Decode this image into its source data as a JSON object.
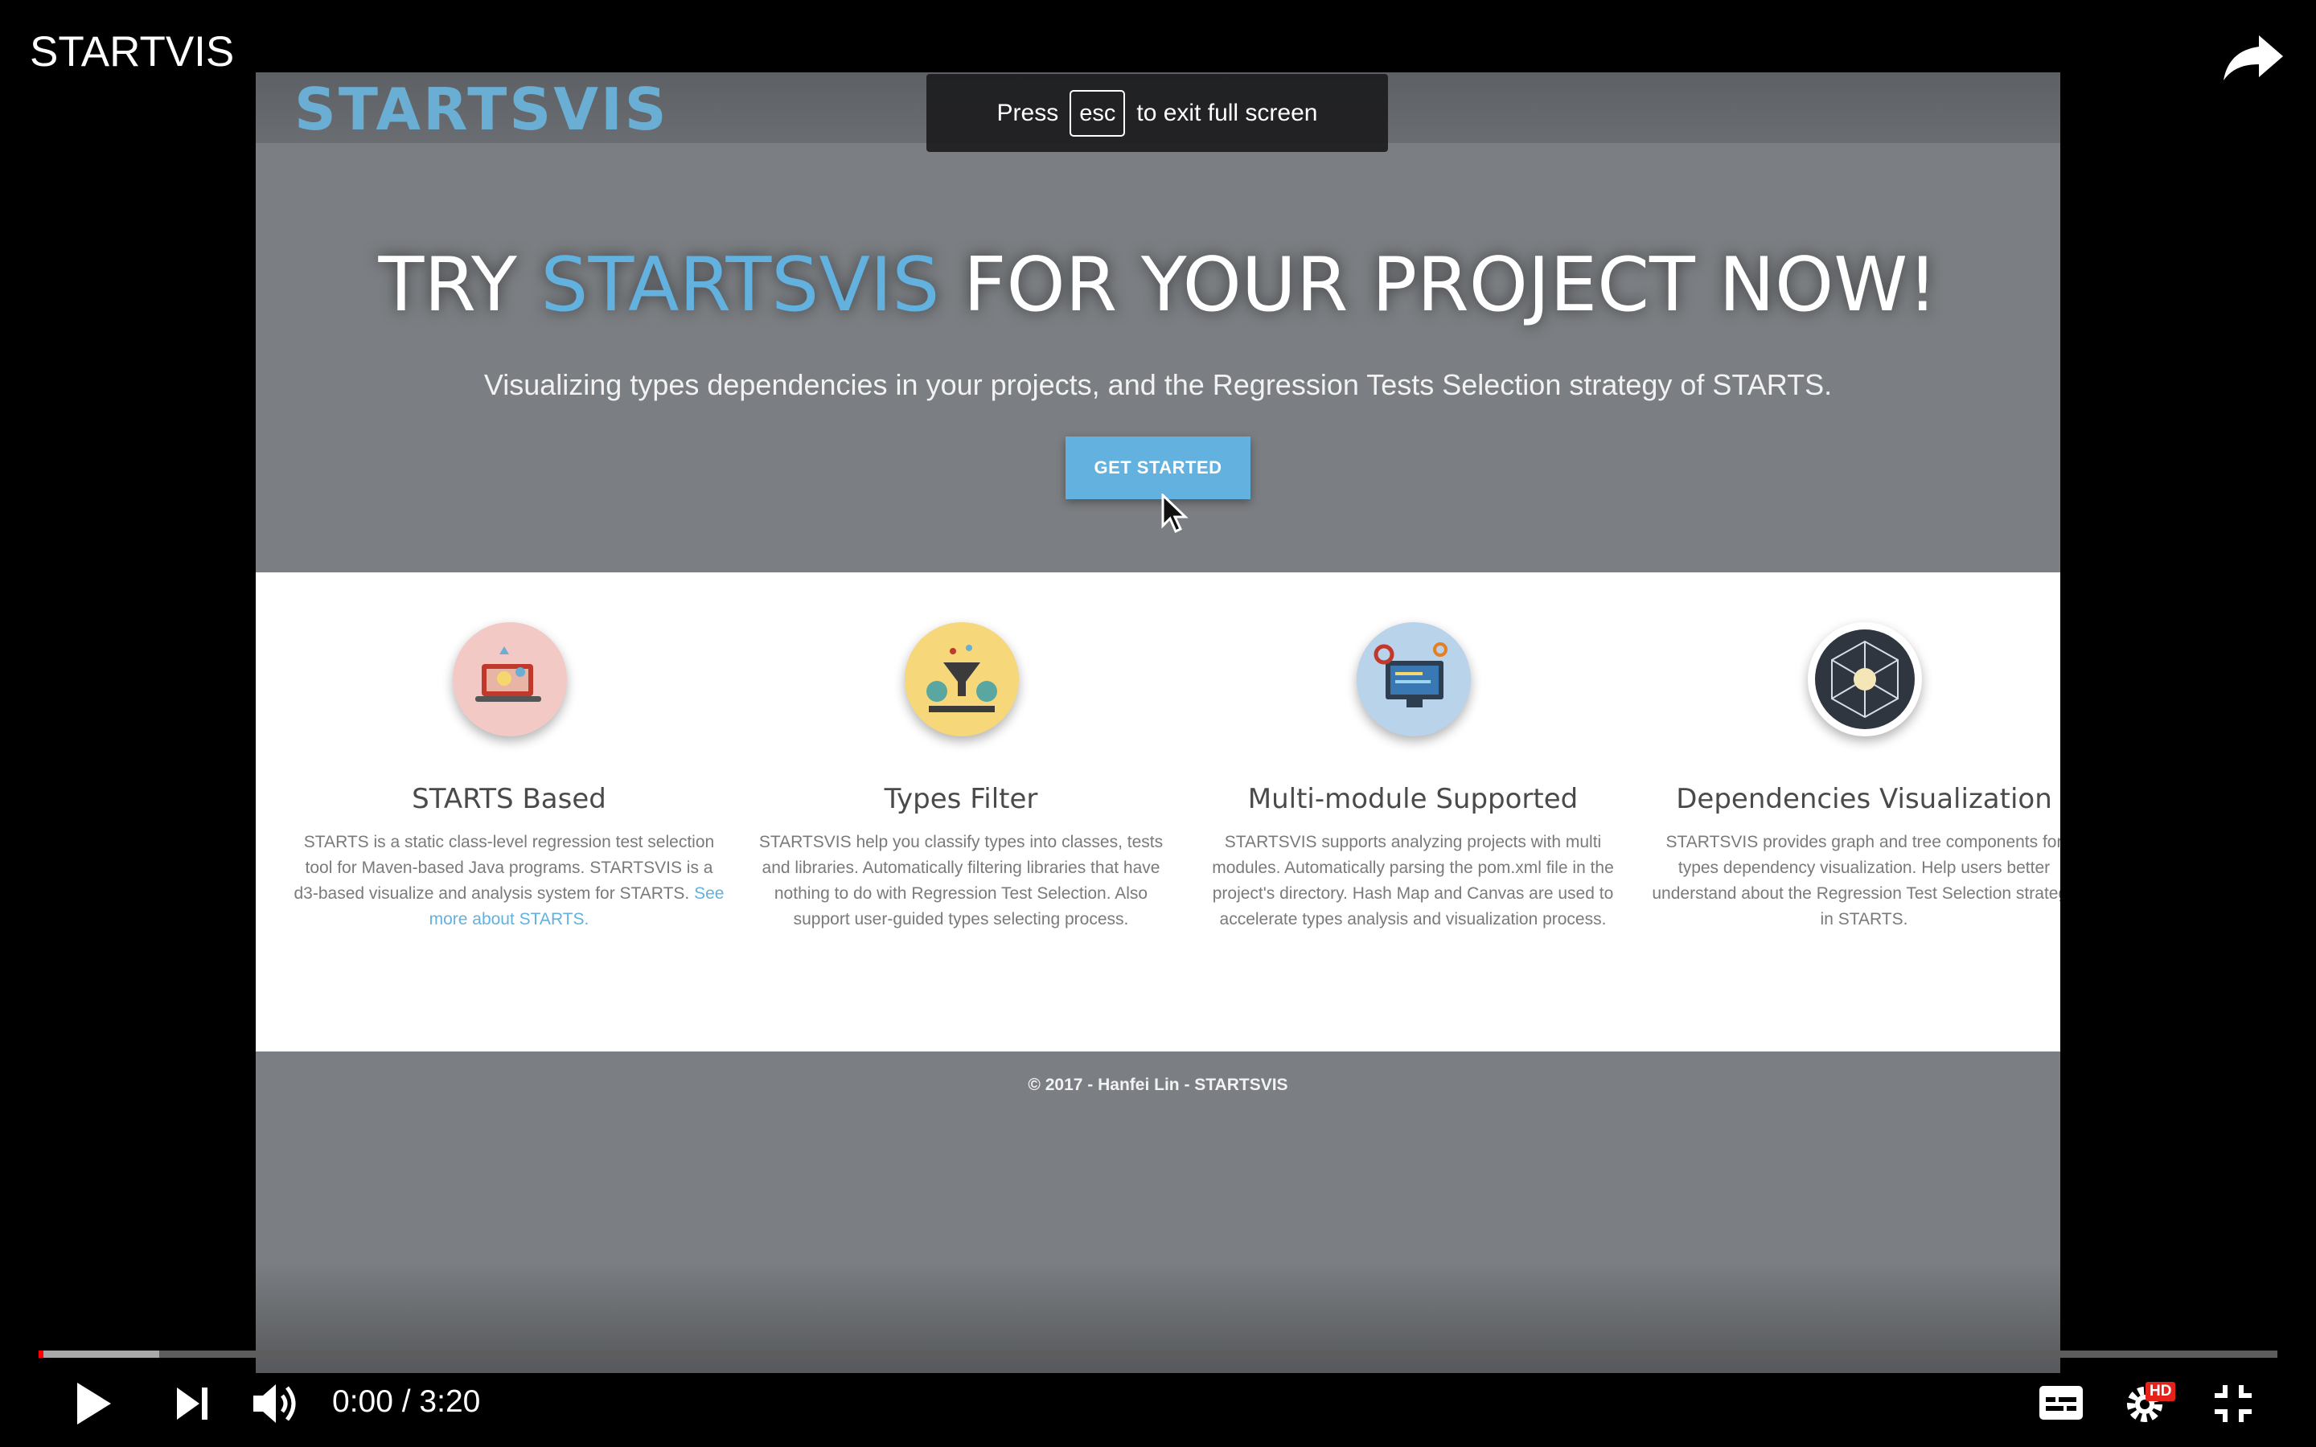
{
  "video": {
    "title": "STARTVIS"
  },
  "fullscreen_toast": {
    "press": "Press",
    "key": "esc",
    "suffix": "to exit full screen"
  },
  "site": {
    "logo": "STARTSVIS",
    "hero": {
      "title_prefix": "TRY ",
      "title_accent": "STARTSVIS",
      "title_suffix": " FOR YOUR PROJECT NOW!",
      "subtitle": "Visualizing types dependencies in your projects, and the Regression Tests Selection strategy of STARTS.",
      "cta_label": "GET STARTED"
    },
    "features": [
      {
        "title": "STARTS Based",
        "description": "STARTS is a static class-level regression test selection tool for Maven-based Java programs. STARTSVIS is a d3-based visualize and analysis system for STARTS.",
        "link": "See more about STARTS."
      },
      {
        "title": "Types Filter",
        "description": "STARTSVIS help you classify types into classes, tests and libraries. Automatically filtering libraries that have nothing to do with Regression Test Selection. Also support user-guided types selecting process."
      },
      {
        "title": "Multi-module Supported",
        "description": "STARTSVIS supports analyzing projects with multi modules. Automatically parsing the pom.xml file in the project's directory. Hash Map and Canvas are used to accelerate types analysis and visualization process."
      },
      {
        "title": "Dependencies Visualization",
        "description": "STARTSVIS provides graph and tree components for types dependency visualization. Help users better understand about the Regression Test Selection strategy in STARTS."
      }
    ],
    "footer": "© 2017 - Hanfei Lin - STARTSVIS"
  },
  "player": {
    "current_time": "0:00",
    "separator": " / ",
    "duration": "3:20",
    "time_display": "0:00 / 3:20",
    "played_fraction": 0.0,
    "buffered_fraction": 0.054,
    "quality_badge": "HD",
    "icons": [
      "play-icon",
      "next-icon",
      "volume-icon",
      "subtitles-icon",
      "settings-icon",
      "exit-fullscreen-icon",
      "share-icon"
    ]
  },
  "colors": {
    "accent": "#62b1de",
    "progress_played": "#ff0000",
    "hd_badge": "#e62117"
  }
}
